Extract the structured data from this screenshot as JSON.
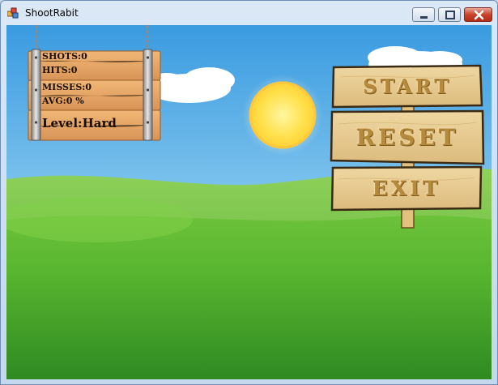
{
  "window": {
    "title": "ShootRabit",
    "controls": {
      "minimize": "minimize-icon",
      "maximize": "maximize-icon",
      "close": "close-icon"
    }
  },
  "scoreboard": {
    "shots": "SHOTS:0",
    "hits": "HITS:0",
    "misses": "MISSES:0",
    "avg": "AVG:0 %",
    "level": "Level:Hard"
  },
  "menu": {
    "start": "START",
    "reset": "RESET",
    "exit": "EXIT"
  },
  "colors": {
    "sky_top": "#3a9be0",
    "sky_bottom": "#bfe6f7",
    "grass": "#5ab236",
    "wood": "#e8a96a",
    "sign_wood": "#e7cc94",
    "sun": "#ffe35a"
  }
}
